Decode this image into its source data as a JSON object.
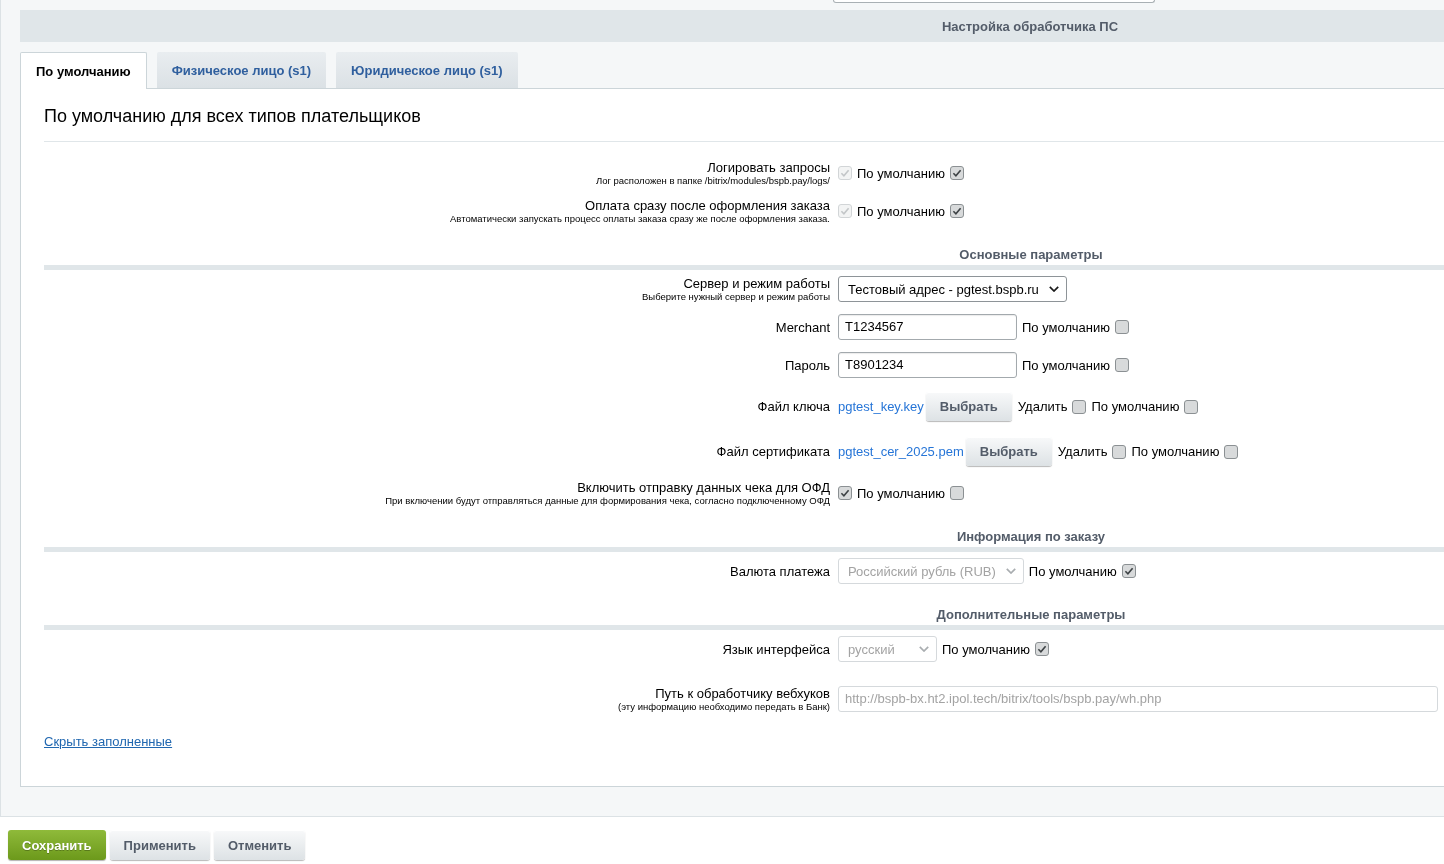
{
  "header": {
    "title": "Настройка обработчика ПС"
  },
  "tabs": [
    {
      "label": "По умолчанию",
      "selected": true
    },
    {
      "label": "Физическое лицо (s1)",
      "selected": false
    },
    {
      "label": "Юридическое лицо (s1)",
      "selected": false
    }
  ],
  "heading": "По умолчанию для всех типов плательщиков",
  "sections": [
    {
      "fields": [
        {
          "kind": "checkbox",
          "label": "Логировать запросы",
          "hint": "Лог расположен в папке /bitrix/modules/bspb.pay/logs/",
          "checked": true,
          "disabled": true,
          "default": {
            "label": "По умолчанию",
            "checked": true
          }
        },
        {
          "kind": "checkbox",
          "label": "Оплата сразу после оформления заказа",
          "hint": "Автоматически запускать процесс оплаты заказа сразу же после оформления заказа.",
          "checked": true,
          "disabled": true,
          "default": {
            "label": "По умолчанию",
            "checked": true
          }
        }
      ]
    },
    {
      "title": "Основные параметры",
      "fields": [
        {
          "kind": "select",
          "label": "Сервер и режим работы",
          "hint": "Выберите нужный сервер и режим работы",
          "value": "Тестовый адрес - pgtest.bspb.ru",
          "disabled": false
        },
        {
          "kind": "text",
          "label": "Merchant",
          "value": "T1234567",
          "disabled": false,
          "default": {
            "label": "По умолчанию",
            "checked": false
          }
        },
        {
          "kind": "text",
          "label": "Пароль",
          "value": "T8901234",
          "disabled": false,
          "default": {
            "label": "По умолчанию",
            "checked": false
          }
        },
        {
          "kind": "file",
          "label": "Файл ключа",
          "file_name": "pgtest_key.key",
          "button": "Выбрать",
          "delete": {
            "label": "Удалить",
            "checked": false
          },
          "default": {
            "label": "По умолчанию",
            "checked": false
          }
        },
        {
          "kind": "file",
          "label": "Файл сертификата",
          "file_name": "pgtest_cer_2025.pem",
          "button": "Выбрать",
          "delete": {
            "label": "Удалить",
            "checked": false
          },
          "default": {
            "label": "По умолчанию",
            "checked": false
          }
        },
        {
          "kind": "checkbox",
          "label": "Включить отправку данных чека для ОФД",
          "hint": "При включении будут отправляться данные для формирования чека, согласно подключенному ОФД",
          "checked": true,
          "disabled": false,
          "default": {
            "label": "По умолчанию",
            "checked": false
          }
        }
      ]
    },
    {
      "title": "Информация по заказу",
      "fields": [
        {
          "kind": "select",
          "label": "Валюта платежа",
          "value": "Российский рубль (RUB)",
          "disabled": true,
          "default": {
            "label": "По умолчанию",
            "checked": true
          }
        }
      ]
    },
    {
      "title": "Дополнительные параметры",
      "fields": [
        {
          "kind": "select",
          "label": "Язык интерфейса",
          "value": "русский",
          "disabled": true,
          "default": {
            "label": "По умолчанию",
            "checked": true
          }
        },
        {
          "kind": "text",
          "label": "Путь к обработчику вебхуков",
          "hint": "(эту информацию необходимо передать в Банк)",
          "value": "http://bspb-bx.ht2.ipol.tech/bitrix/tools/bspb.pay/wh.php",
          "disabled": true
        }
      ]
    }
  ],
  "hide_filled_link": "Скрыть заполненные",
  "buttons": [
    {
      "label": "Сохранить",
      "kind": "primary"
    },
    {
      "label": "Применить",
      "kind": "secondary"
    },
    {
      "label": "Отменить",
      "kind": "secondary"
    }
  ]
}
